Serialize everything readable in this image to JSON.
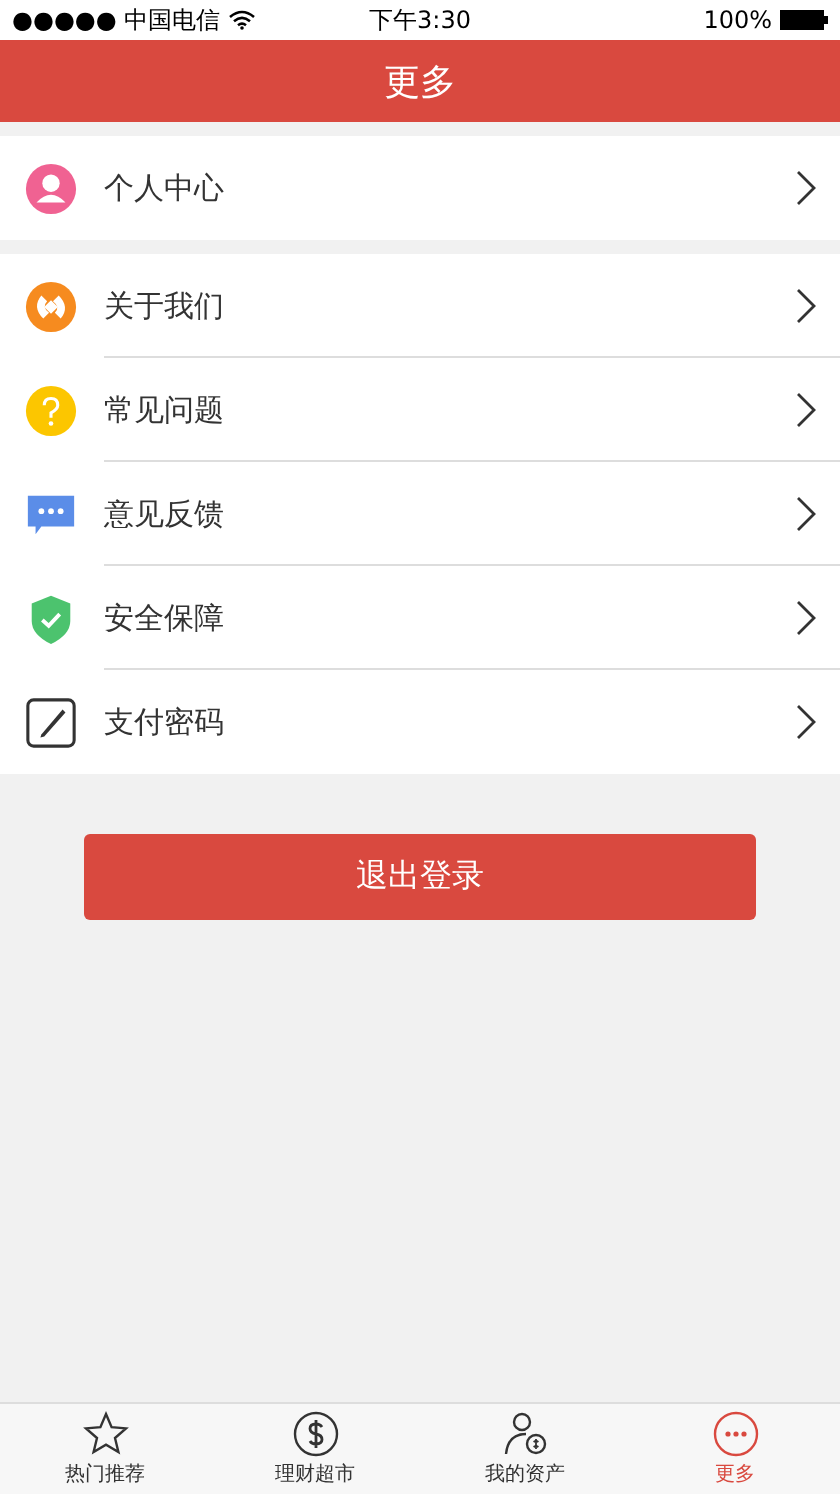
{
  "status_bar": {
    "carrier": "●●●●● 中国电信",
    "time": "下午3:30",
    "battery": "100%"
  },
  "header": {
    "title": "更多"
  },
  "groups": [
    {
      "items": [
        {
          "kind": "profile",
          "label": "个人中心"
        }
      ]
    },
    {
      "items": [
        {
          "kind": "about",
          "label": "关于我们"
        },
        {
          "kind": "faq",
          "label": "常见问题"
        },
        {
          "kind": "feedback",
          "label": "意见反馈"
        },
        {
          "kind": "security",
          "label": "安全保障"
        },
        {
          "kind": "password",
          "label": "支付密码"
        }
      ]
    }
  ],
  "logout_button": "退出登录",
  "tab_bar": [
    {
      "kind": "star",
      "label": "热门推荐",
      "selected": false
    },
    {
      "kind": "dollar",
      "label": "理财超市",
      "selected": false
    },
    {
      "kind": "person",
      "label": "我的资产",
      "selected": false
    },
    {
      "kind": "more",
      "label": "更多",
      "selected": true
    }
  ]
}
